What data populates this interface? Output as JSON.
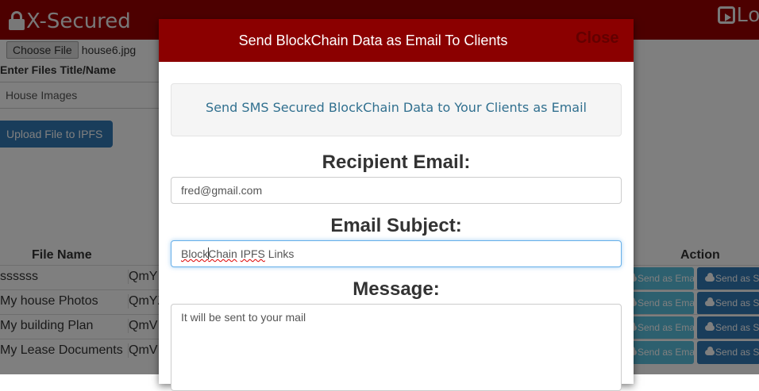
{
  "navbar": {
    "brand": "X-Secured",
    "logout": "Log"
  },
  "upload_form": {
    "choose_file_label": "Choose File",
    "selected_file": "house6.jpg",
    "title_label": "Enter Files Title/Name",
    "title_value": "House Images",
    "upload_button": "Upload File to IPFS"
  },
  "files_table": {
    "headers": {
      "file_name": "File Name",
      "action": "Action"
    },
    "rows": [
      {
        "name": "ssssss",
        "hash": "QmYI"
      },
      {
        "name": "My house Photos",
        "hash": "QmYZ"
      },
      {
        "name": "My building Plan",
        "hash": "QmVI"
      },
      {
        "name": "My Lease Documents",
        "hash": "QmVI"
      }
    ],
    "email_button": "Send as Email",
    "sms_button": "Send as SMS"
  },
  "modal": {
    "title": "Send BlockChain Data as Email To Clients",
    "close": "Close",
    "info_text": "Send SMS Secured BlockChain Data to Your Clients as Email",
    "recipient_label": "Recipient Email:",
    "recipient_value": "fred@gmail.com",
    "subject_label": "Email Subject:",
    "subject_parts": {
      "word1a": "Block",
      "word1b": "Chain",
      "word2": "IPFS",
      "rest": " Links"
    },
    "message_label": "Message:",
    "message_value": "It will be sent to your mail"
  },
  "colors": {
    "navbar": "#9b0000",
    "modal_header": "#8b0000",
    "primary": "#337ab7",
    "info": "#5bc0de"
  }
}
